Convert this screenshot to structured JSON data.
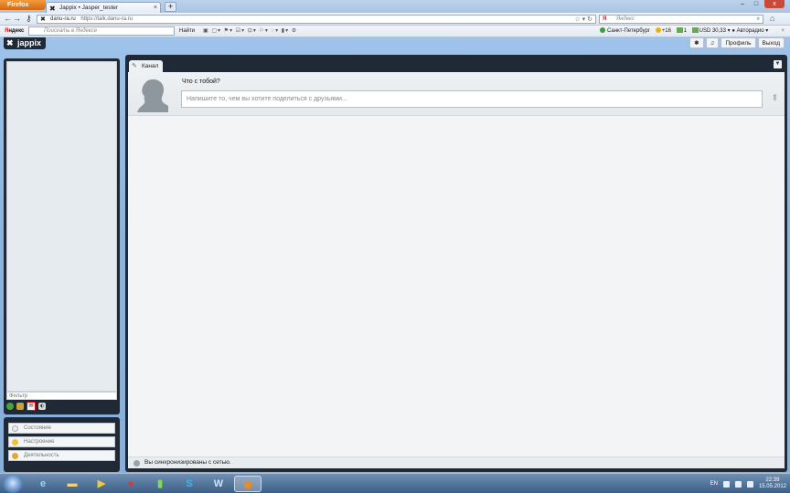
{
  "browser": {
    "menu_button": "Firefox",
    "tab": {
      "title": "Jappix • Jasper_tester",
      "close": "×"
    },
    "new_tab": "+",
    "window_controls": {
      "minimize": "–",
      "maximize": "□",
      "close": "x"
    },
    "nav": {
      "back": "←",
      "forward": "→",
      "site_badge": "danu-ra.ru",
      "url": "https://talk.danu-ra.ru",
      "search_placeholder": "Яндекс"
    },
    "yandex_bar": {
      "logo_prefix": "Я",
      "logo_rest": "ндекс",
      "search_placeholder": "Поискать в Яндексе",
      "find_button": "Найти",
      "city": "Санкт-Петербург",
      "temperature": "+16",
      "rate_count": "1",
      "currency": "USD 30,33",
      "radio": "Авторадио"
    }
  },
  "jappix": {
    "logo": "jappix",
    "top_right": {
      "star": "✱",
      "music": "♫",
      "profile": "Профиль",
      "logout": "Выход"
    },
    "roster": {
      "filter_placeholder": "Фильтр"
    },
    "presence": {
      "state": "Состояние",
      "mood": "Настроение",
      "activity": "Деятельность"
    },
    "feed": {
      "tab_label": "Канал",
      "prompt": "Что с тобой?",
      "input_placeholder": "Напишите то, чем вы хотите поделиться с друзьями...",
      "sync_status": "Вы синхронизированы с сетью."
    }
  },
  "taskbar": {
    "language": "EN",
    "time": "22:39",
    "date": "15.05.2012"
  },
  "colors": {
    "page_background": "#8fb6de",
    "panel_dark": "#1f2a36",
    "content_bg": "#f3f4f5"
  }
}
